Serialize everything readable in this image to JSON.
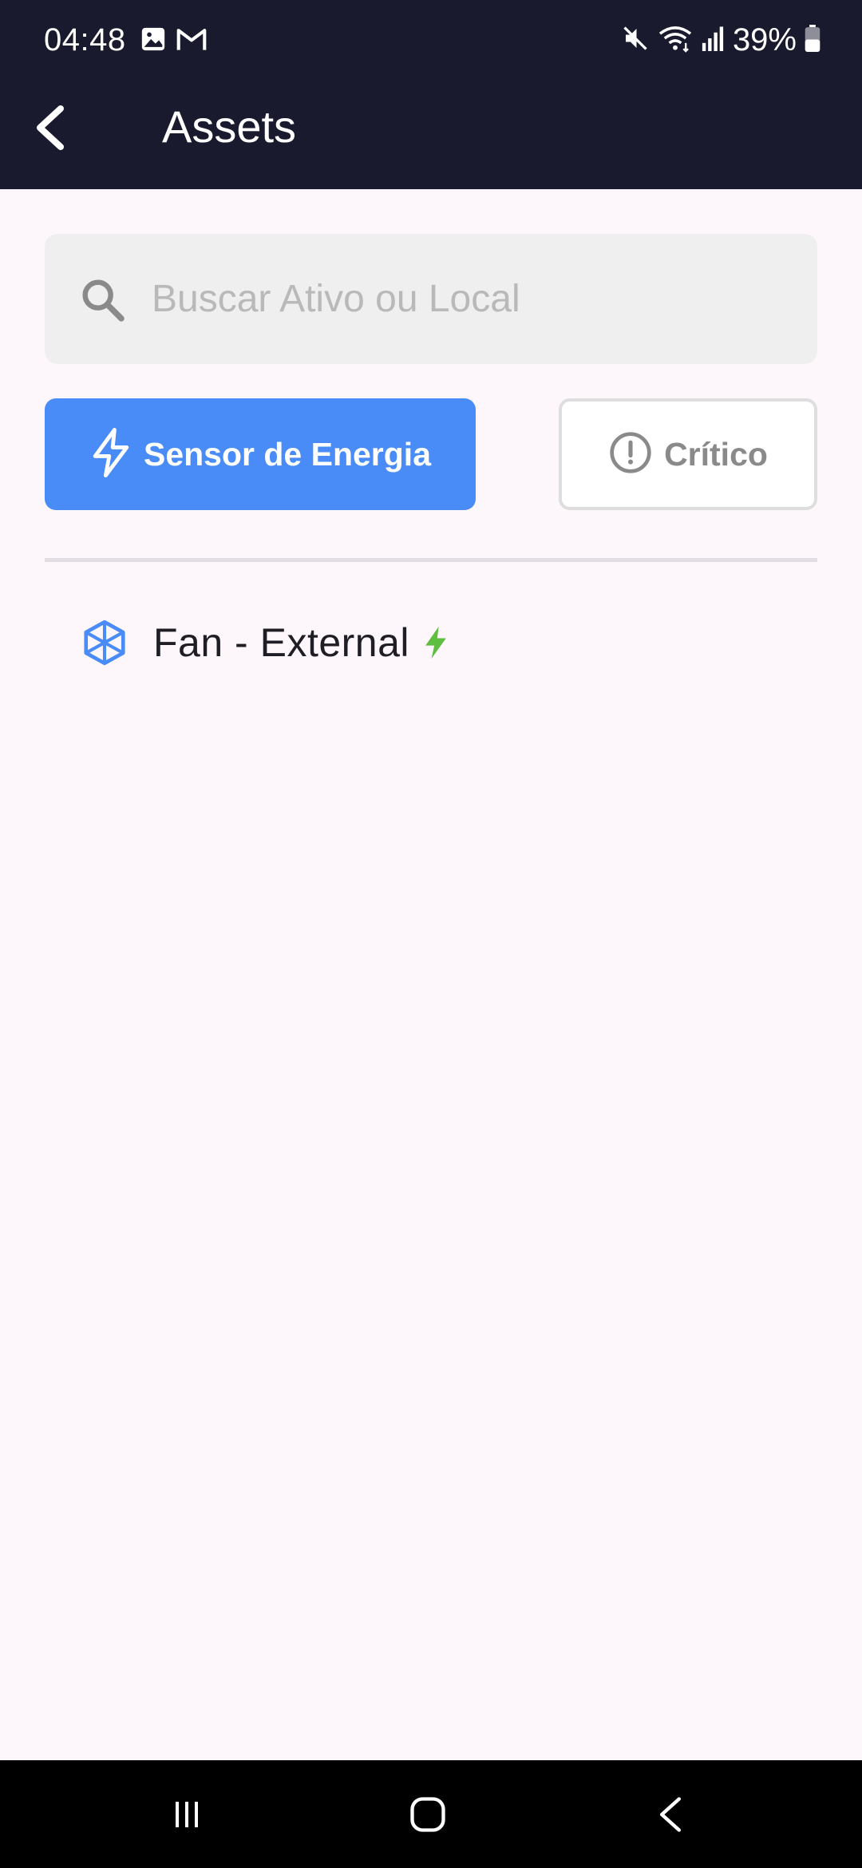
{
  "status_bar": {
    "time": "04:48",
    "battery": "39%",
    "icons": [
      "image-icon",
      "gmail-icon",
      "mute-icon",
      "wifi-icon",
      "signal-icon",
      "battery-icon"
    ]
  },
  "app_bar": {
    "title": "Assets",
    "back_icon": "back-arrow-icon"
  },
  "search": {
    "placeholder": "Buscar Ativo ou Local",
    "value": "",
    "icon": "search-icon"
  },
  "filters": {
    "energy": {
      "label": "Sensor de Energia",
      "icon": "lightning-icon",
      "selected": true
    },
    "critical": {
      "label": "Crítico",
      "icon": "alert-circle-icon",
      "selected": false
    }
  },
  "assets": [
    {
      "label": "Fan - External",
      "icon": "component-cube-icon",
      "status_icon": "energy-bolt-icon"
    }
  ],
  "nav_bar": {
    "buttons": [
      "recent-apps",
      "home",
      "back"
    ]
  },
  "colors": {
    "header_bg": "#191A2E",
    "page_bg": "#FDF7FC",
    "primary": "#4A8CF7",
    "energy_green": "#5DBE3F",
    "search_bg": "#EFEFEF"
  }
}
